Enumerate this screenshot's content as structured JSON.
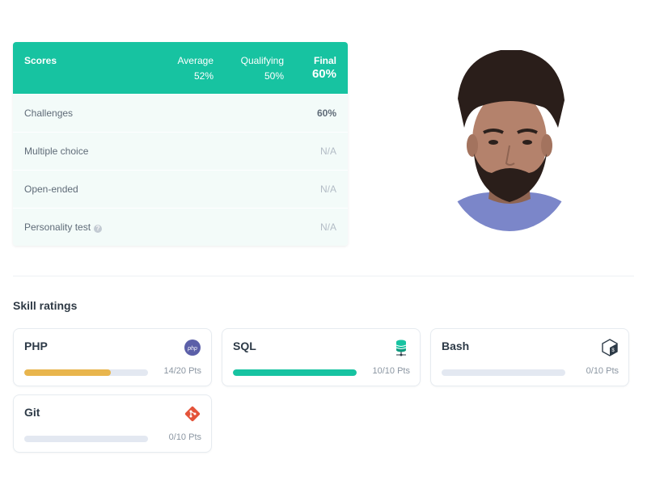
{
  "scores": {
    "title": "Scores",
    "average_label": "Average",
    "average_value": "52%",
    "qualifying_label": "Qualifying",
    "qualifying_value": "50%",
    "final_label": "Final",
    "final_value": "60%",
    "rows": [
      {
        "label": "Challenges",
        "value": "60%"
      },
      {
        "label": "Multiple choice",
        "value": "N/A"
      },
      {
        "label": "Open-ended",
        "value": "N/A"
      },
      {
        "label": "Personality test",
        "value": "N/A"
      }
    ]
  },
  "skills": {
    "title": "Skill ratings",
    "items": [
      {
        "name": "PHP",
        "points": "14/20 Pts",
        "progress": 0.7,
        "color": "#e8b54d",
        "icon": "php-icon"
      },
      {
        "name": "SQL",
        "points": "10/10 Pts",
        "progress": 1.0,
        "color": "#17c3a1",
        "icon": "database-icon"
      },
      {
        "name": "Bash",
        "points": "0/10 Pts",
        "progress": 0.0,
        "color": "#e3e8f1",
        "icon": "bash-icon"
      },
      {
        "name": "Git",
        "points": "0/10 Pts",
        "progress": 0.0,
        "color": "#e3e8f1",
        "icon": "git-icon"
      }
    ]
  },
  "colors": {
    "accent": "#17c3a1",
    "row_background": "#f3fbf9",
    "php_bar": "#e8b54d"
  }
}
